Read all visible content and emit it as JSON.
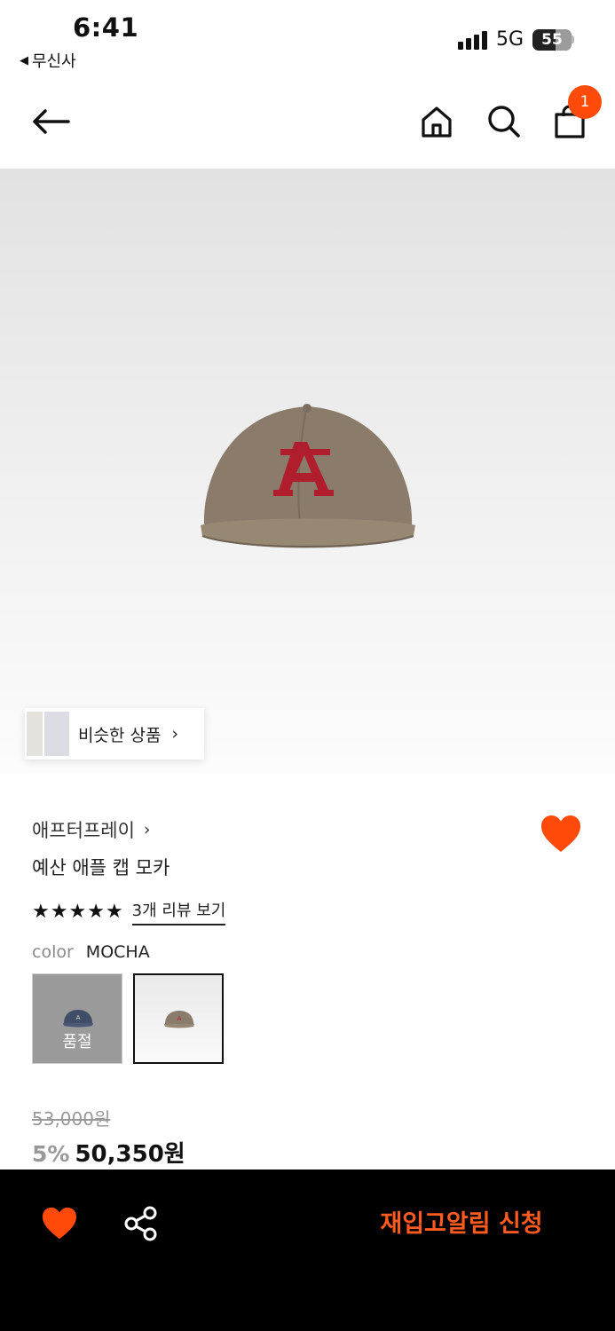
{
  "status_bar": {
    "time": "6:41",
    "back_app": "무신사",
    "network": "5G",
    "battery": "55"
  },
  "nav": {
    "back_icon": "arrow-left-icon",
    "home_icon": "home-icon",
    "search_icon": "search-icon",
    "cart_icon": "shopping-bag-icon",
    "cart_count": "1"
  },
  "product": {
    "similar_label": "비슷한 상품",
    "brand": "애프터프레이",
    "name": "예산 애플 캡 모카",
    "rating_stars": 5,
    "review_link": "3개 리뷰 보기",
    "color_label": "color",
    "color_value": "MOCHA",
    "swatches": [
      {
        "color": "NAVY",
        "status": "품절"
      },
      {
        "color": "MOCHA",
        "status": ""
      }
    ],
    "original_price": "53,000원",
    "discount": "5%",
    "sale_price": "50,350원"
  },
  "bottom_bar": {
    "like_icon": "heart-icon",
    "share_icon": "share-icon",
    "restock_label": "재입고알림 신청"
  },
  "colors": {
    "accent": "#ff4a0a",
    "cap_body": "#8a7a69",
    "cap_logo": "#b01e2e",
    "bottom_bg": "#000000"
  }
}
